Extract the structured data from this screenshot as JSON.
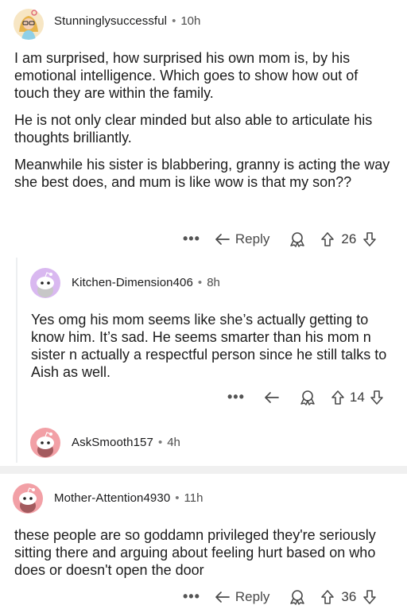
{
  "comments": [
    {
      "user": "Stunninglysuccessful",
      "time": "10h",
      "paragraphs": [
        "I am surprised, how surprised his own mom is, by his emotional intelligence. Which goes to show how out of touch they are within the family.",
        "He is not only clear minded but also able to articulate his thoughts brilliantly.",
        "Meanwhile his sister is blabbering, granny is acting the way she best does, and mum is like wow is that my son??"
      ],
      "more": "•••",
      "reply_label": "Reply",
      "votes": "26"
    },
    {
      "user": "Kitchen-Dimension406",
      "time": "8h",
      "paragraphs": [
        "Yes omg his mom seems like she’s actually getting to know him. It’s sad. He seems smarter than his mom n sister n actually a respectful person since he still talks to Aish as well."
      ],
      "more": "•••",
      "votes": "14"
    },
    {
      "user": "AskSmooth157",
      "time": "4h"
    },
    {
      "user": "Mother-Attention4930",
      "time": "11h",
      "paragraphs": [
        "these people are so goddamn privileged they're seriously sitting there and arguing about feeling hurt based on who does or doesn't open the door"
      ],
      "more": "•••",
      "reply_label": "Reply",
      "votes": "36"
    }
  ],
  "meta_separator": "•",
  "colors": {
    "text": "#1c1c1c",
    "muted": "#4b4b4b",
    "avatar_purple": "#d9b8f0",
    "avatar_pink": "#f2a0a6",
    "thread_line": "#edeff1"
  },
  "icons": {
    "reply": "reply-arrow-icon",
    "award": "award-icon",
    "upvote": "upvote-arrow-icon",
    "downvote": "downvote-arrow-icon"
  }
}
